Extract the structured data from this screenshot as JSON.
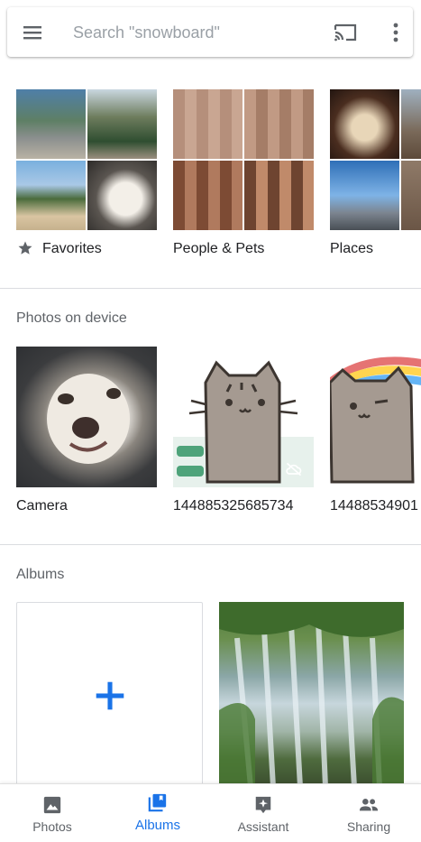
{
  "search": {
    "placeholder": "Search \"snowboard\""
  },
  "categories": [
    {
      "label": "Favorites",
      "icon": "star-icon"
    },
    {
      "label": "People & Pets"
    },
    {
      "label": "Places"
    }
  ],
  "device": {
    "title": "Photos on device",
    "folders": [
      {
        "label": "Camera"
      },
      {
        "label": "144885325685734"
      },
      {
        "label": "14488534901"
      }
    ]
  },
  "albums": {
    "title": "Albums"
  },
  "nav": [
    {
      "label": "Photos",
      "icon": "photo-icon"
    },
    {
      "label": "Albums",
      "icon": "albums-icon"
    },
    {
      "label": "Assistant",
      "icon": "assistant-icon"
    },
    {
      "label": "Sharing",
      "icon": "people-icon"
    }
  ],
  "colors": {
    "accent": "#1a73e8",
    "text": "#202124",
    "muted": "#5f6368"
  }
}
